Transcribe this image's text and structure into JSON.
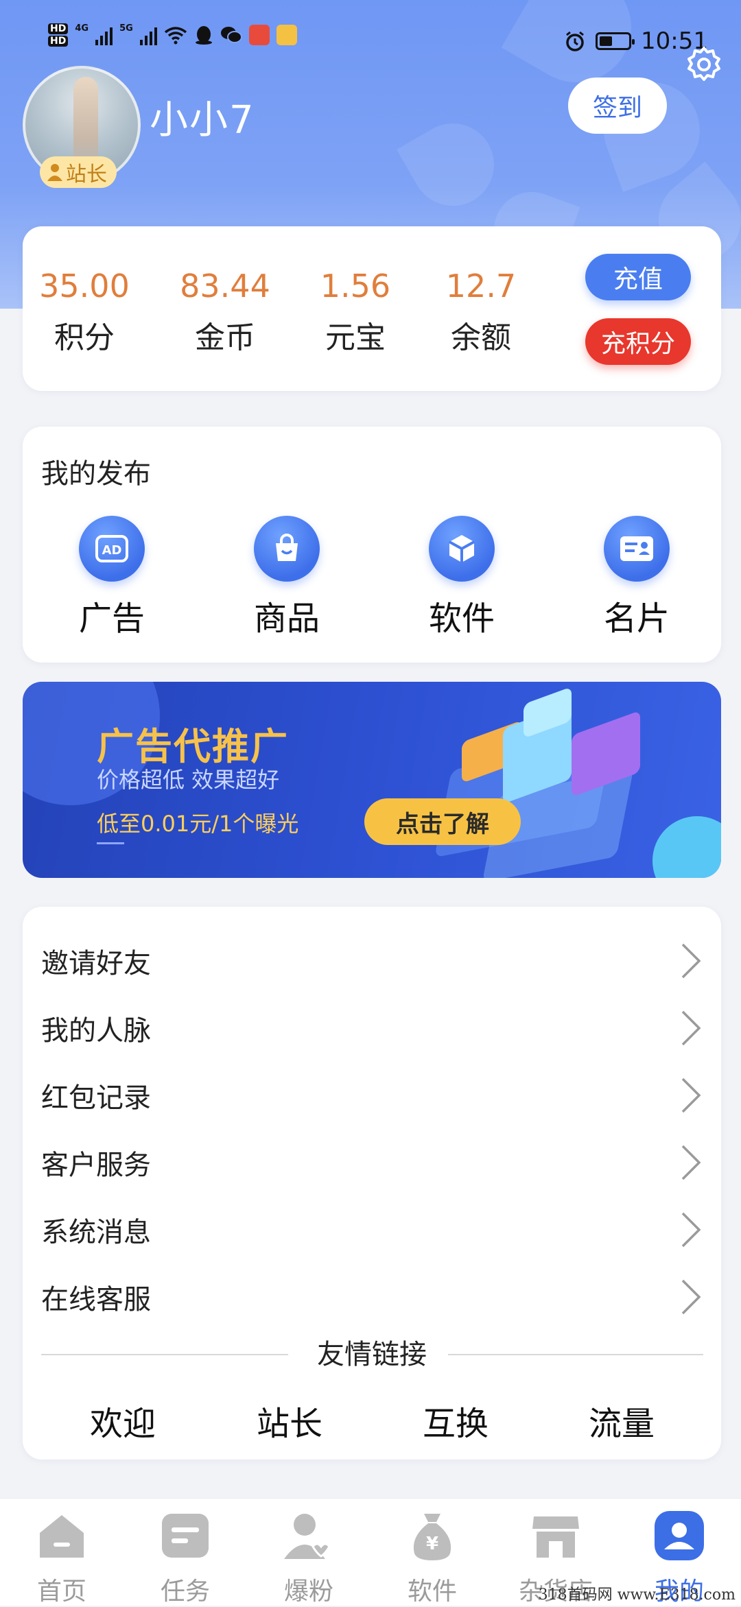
{
  "status_bar": {
    "left_indicators": [
      "HD",
      "HD",
      "4G",
      "5G"
    ],
    "time": "10:51",
    "battery_level": 0.4,
    "app_icons": [
      "wifi-icon",
      "qq-icon",
      "wechat-icon",
      "news-app-icon",
      "weibo-icon"
    ]
  },
  "profile": {
    "username": "小小7",
    "role_badge": "站长",
    "signin_label": "签到",
    "settings_icon": "gear-icon"
  },
  "stats": [
    {
      "value": "35.00",
      "label": "积分"
    },
    {
      "value": "83.44",
      "label": "金币"
    },
    {
      "value": "1.56",
      "label": "元宝"
    },
    {
      "value": "12.7",
      "label": "余额"
    }
  ],
  "stats_actions": {
    "recharge": "充值",
    "recharge_points": "充积分"
  },
  "publish": {
    "title": "我的发布",
    "items": [
      {
        "label": "广告",
        "icon": "ad-icon"
      },
      {
        "label": "商品",
        "icon": "shopping-bag-icon"
      },
      {
        "label": "软件",
        "icon": "cube-icon"
      },
      {
        "label": "名片",
        "icon": "id-card-icon"
      }
    ]
  },
  "banner": {
    "title": "广告代推广",
    "subtitle": "价格超低 效果超好",
    "price_text": "低至0.01元/1个曝光",
    "cta": "点击了解"
  },
  "menu": {
    "items": [
      {
        "label": "邀请好友"
      },
      {
        "label": "我的人脉"
      },
      {
        "label": "红包记录"
      },
      {
        "label": "客户服务"
      },
      {
        "label": "系统消息"
      },
      {
        "label": "在线客服"
      }
    ],
    "friends_title": "友情链接",
    "friends": [
      "欢迎",
      "站长",
      "互换",
      "流量"
    ]
  },
  "tabbar": [
    {
      "label": "首页",
      "icon": "home-icon",
      "active": false
    },
    {
      "label": "任务",
      "icon": "task-icon",
      "active": false
    },
    {
      "label": "爆粉",
      "icon": "fans-icon",
      "active": false
    },
    {
      "label": "软件",
      "icon": "money-bag-icon",
      "active": false
    },
    {
      "label": "杂货店",
      "icon": "store-icon",
      "active": false
    },
    {
      "label": "我的",
      "icon": "user-icon",
      "active": true
    }
  ],
  "watermark": "318首码网  www.E318.com",
  "colors": {
    "accent": "#3c6ee6",
    "stat_value": "#e07e3c",
    "danger": "#e8372d",
    "banner_gold": "#f7c24a"
  }
}
